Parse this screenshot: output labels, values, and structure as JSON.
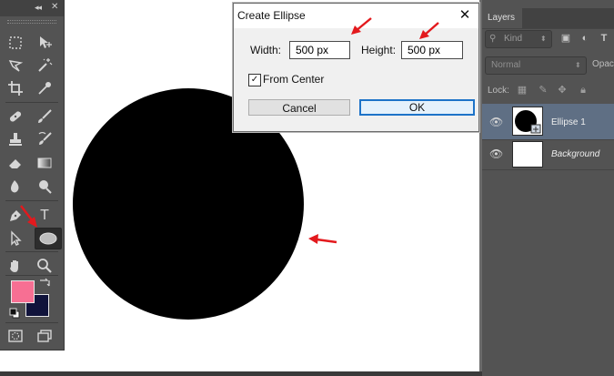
{
  "toolbox": {
    "collapse_glyph": "◂◂",
    "close_glyph": "✕",
    "tools": {
      "marquee": "marquee-tool",
      "move": "move-tool",
      "lasso": "lasso-tool",
      "magic_wand": "magic-wand-tool",
      "crop": "crop-tool",
      "eyedropper": "eyedropper-tool",
      "healing": "healing-brush-tool",
      "brush": "brush-tool",
      "stamp": "clone-stamp-tool",
      "history_brush": "history-brush-tool",
      "eraser": "eraser-tool",
      "gradient": "gradient-tool",
      "blur": "blur-tool",
      "dodge": "dodge-tool",
      "pen": "pen-tool",
      "type": "T",
      "path_select": "path-selection-tool",
      "ellipse": "ellipse-tool",
      "hand": "hand-tool",
      "zoom": "zoom-tool",
      "quick_mask": "quick-mask",
      "screen_mode": "screen-mode"
    },
    "foreground_color": "#f76f93",
    "background_color": "#10133b"
  },
  "canvas": {
    "shape_color": "#000000"
  },
  "dialog": {
    "title": "Create Ellipse",
    "close_glyph": "✕",
    "width_label": "Width:",
    "width_value": "500 px",
    "height_label": "Height:",
    "height_value": "500 px",
    "from_center_label": "From Center",
    "from_center_checked": true,
    "check_glyph": "✓",
    "cancel_label": "Cancel",
    "ok_label": "OK"
  },
  "layers_panel": {
    "tab_label": "Layers",
    "filter_label": "Kind",
    "blend_mode": "Normal",
    "opacity_label": "Opac",
    "lock_label": "Lock:",
    "layers": [
      {
        "name": "Ellipse 1",
        "visible": true,
        "selected": true
      },
      {
        "name": "Background",
        "visible": true,
        "selected": false
      }
    ]
  },
  "colors": {
    "annotation_arrow": "#e3191d",
    "selected_layer": "#5f6f84",
    "ok_border": "#1d73c8"
  }
}
